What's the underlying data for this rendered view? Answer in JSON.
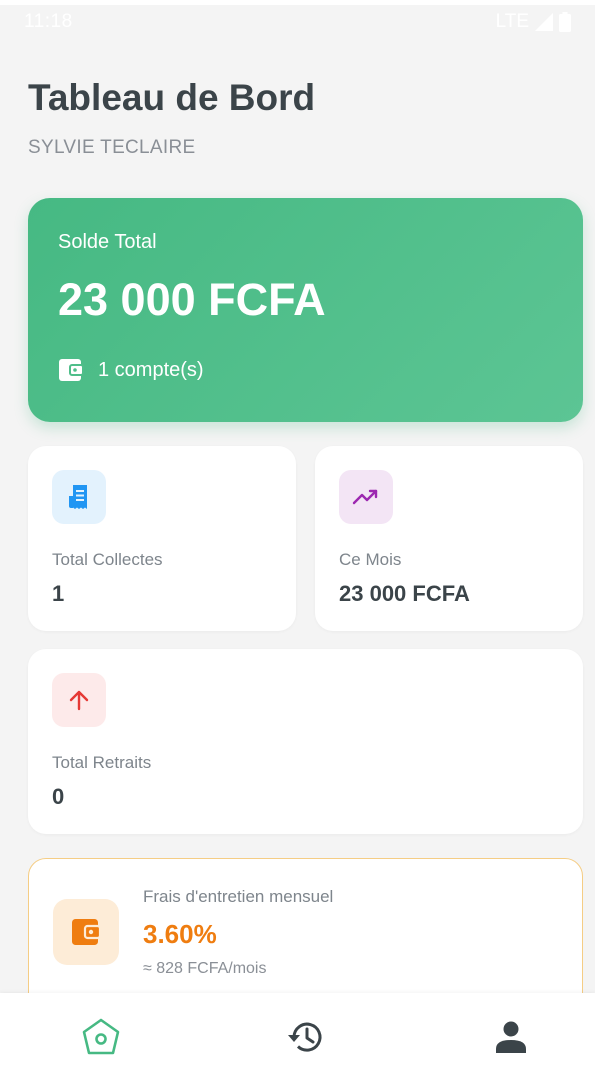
{
  "status_bar": {
    "time": "11:18",
    "network": "LTE"
  },
  "header": {
    "title": "Tableau de Bord",
    "user_name": "SYLVIE TECLAIRE"
  },
  "balance": {
    "label": "Solde Total",
    "value": "23 000 FCFA",
    "accounts": "1 compte(s)",
    "icon": "wallet-icon"
  },
  "stats": {
    "collectes": {
      "label": "Total Collectes",
      "value": "1",
      "icon": "receipt-icon",
      "color": "#2196f3"
    },
    "mois": {
      "label": "Ce Mois",
      "value": "23 000 FCFA",
      "icon": "trending-up-icon",
      "color": "#9c27b0"
    },
    "retraits": {
      "label": "Total Retraits",
      "value": "0",
      "icon": "arrow-up-icon",
      "color": "#e53935"
    }
  },
  "fees": {
    "label": "Frais d'entretien mensuel",
    "rate": "3.60%",
    "amount": "≈ 828 FCFA/mois",
    "icon": "wallet-icon",
    "color": "#ef7d10"
  },
  "colors": {
    "primary": "#46b983",
    "title": "#3b4449",
    "background": "#f4f4f4"
  },
  "bottom_nav": {
    "items": [
      {
        "name": "home",
        "icon": "home-icon",
        "active": true
      },
      {
        "name": "history",
        "icon": "history-icon",
        "active": false
      },
      {
        "name": "profile",
        "icon": "person-icon",
        "active": false
      }
    ]
  }
}
